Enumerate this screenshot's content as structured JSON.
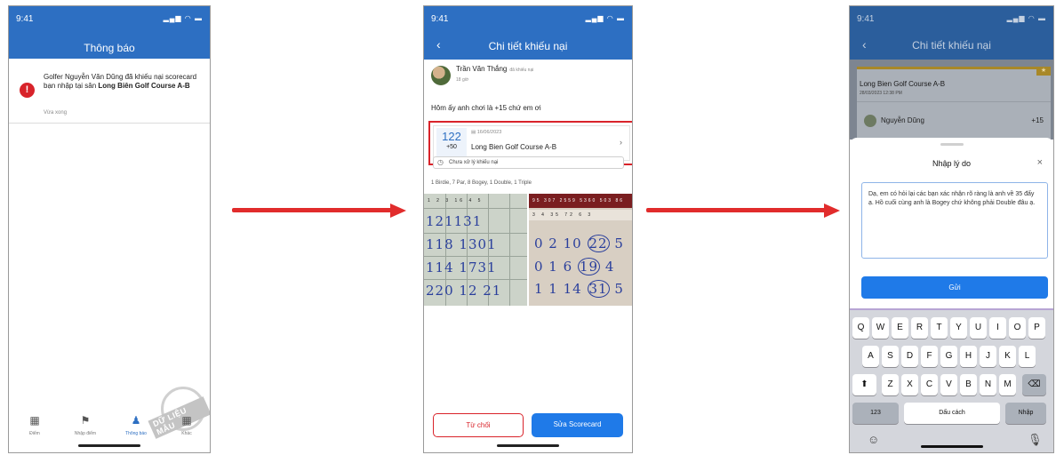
{
  "phone1": {
    "status_time": "9:41",
    "status_icons": "▂▄▆ ◠ ▬",
    "header_title": "Thông báo",
    "notification": {
      "text_prefix": "Golfer Nguyễn Văn Dũng đã khiếu nại scorecard bạn nhập tại sân ",
      "text_course": "Long Biên Golf Course A-B",
      "time": "Vừa xong",
      "alert_icon": "!"
    },
    "tabs": [
      {
        "label": "Điểm",
        "icon": "▦"
      },
      {
        "label": "Nhập điểm",
        "icon": "⚑"
      },
      {
        "label": "Thông báo",
        "icon": "♟"
      },
      {
        "label": "Khác",
        "icon": "▦"
      }
    ],
    "watermark": "DỮ LIỆU MẪU"
  },
  "phone2": {
    "status_time": "9:41",
    "status_icons": "▂▄▆ ◠ ▬",
    "header_title": "Chi tiết khiếu nại",
    "back_icon": "‹",
    "poster_name": "Trần Văn Thắng",
    "posted_tag": "đã khiếu nại",
    "post_time": "18 giờ",
    "complaint_text": "Hôm ấy anh chơi là +15 chứ em ơi",
    "scorecard": {
      "score": "122",
      "over_par": "+50",
      "date": "16/06/2023",
      "calendar_icon": "▤",
      "course": "Long Bien Golf Course A-B",
      "chevron": "›"
    },
    "status_text": "Chưa xử lý khiếu nại",
    "clock_icon": "◷",
    "stats": "1 Birdie, 7 Par, 8 Bogey, 1 Double, 1 Triple",
    "photo_a_rows": [
      "121131",
      "118 1301",
      "114 1731",
      "220 12 21"
    ],
    "photo_a_header": "1 2 3 16 4 5",
    "photo_b_header": "95 307 2559 5360 503 86",
    "photo_b_sub": "3 4 35 72 6 3",
    "photo_b_rows": [
      {
        "a": "0 2 10",
        "c": "22",
        "d": "5"
      },
      {
        "a": "0 1 6",
        "c": "19",
        "d": "4"
      },
      {
        "a": "1 1 14",
        "c": "31",
        "d": "5"
      }
    ],
    "reject_label": "Từ chối",
    "edit_label": "Sửa Scorecard"
  },
  "phone3": {
    "status_time": "9:41",
    "status_icons": "▂▄▆ ◠ ▬",
    "header_title": "Chi tiết khiếu nại",
    "back_icon": "‹",
    "bg_course": "Long Bien Golf Course A-B",
    "bg_date": "28/03/2023 12:38 PM",
    "bg_player": "Nguyễn Dũng",
    "bg_over": "+15",
    "star": "★",
    "sheet_title": "Nhập lý do",
    "close_icon": "×",
    "reason_text": "Dạ, em có hỏi lại các bạn xác nhận rõ ràng là anh về 35 đấy ạ. Hồ cuối cùng anh là Bogey chứ không phải Double đâu ạ.",
    "send_label": "Gửi",
    "keyboard": {
      "row1": [
        "Q",
        "W",
        "E",
        "R",
        "T",
        "Y",
        "U",
        "I",
        "O",
        "P"
      ],
      "row2": [
        "A",
        "S",
        "D",
        "F",
        "G",
        "H",
        "J",
        "K",
        "L"
      ],
      "row3": [
        "Z",
        "X",
        "C",
        "V",
        "B",
        "N",
        "M"
      ],
      "shift": "⬆",
      "backspace": "⌫",
      "numbers": "123",
      "space": "Dấu cách",
      "return": "Nhập",
      "emoji": "☺",
      "mic": "🎙"
    }
  }
}
